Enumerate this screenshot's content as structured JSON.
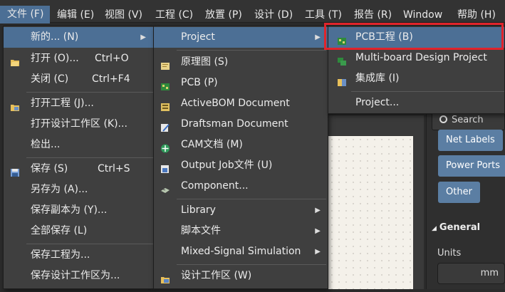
{
  "menubar": {
    "items": [
      {
        "label": "文件 (F)"
      },
      {
        "label": "编辑 (E)"
      },
      {
        "label": "视图 (V)"
      },
      {
        "label": "工程 (C)"
      },
      {
        "label": "放置 (P)"
      },
      {
        "label": "设计 (D)"
      },
      {
        "label": "工具 (T)"
      },
      {
        "label": "报告 (R)"
      },
      {
        "label": "Window"
      },
      {
        "label": "帮助 (H)"
      }
    ]
  },
  "file_menu": {
    "items": [
      {
        "label": "新的... (N)",
        "shortcut": ""
      },
      {
        "label": "打开 (O)...",
        "shortcut": "Ctrl+O"
      },
      {
        "label": "关闭 (C)",
        "shortcut": "Ctrl+F4"
      },
      {
        "label": "打开工程 (J)...",
        "shortcut": ""
      },
      {
        "label": "打开设计工作区 (K)...",
        "shortcut": ""
      },
      {
        "label": "检出...",
        "shortcut": ""
      },
      {
        "label": "保存 (S)",
        "shortcut": "Ctrl+S"
      },
      {
        "label": "另存为 (A)...",
        "shortcut": ""
      },
      {
        "label": "保存副本为 (Y)...",
        "shortcut": ""
      },
      {
        "label": "全部保存 (L)",
        "shortcut": ""
      },
      {
        "label": "保存工程为...",
        "shortcut": ""
      },
      {
        "label": "保存设计工作区为...",
        "shortcut": ""
      }
    ]
  },
  "new_menu": {
    "items": [
      {
        "label": "Project"
      },
      {
        "label": "原理图 (S)"
      },
      {
        "label": "PCB (P)"
      },
      {
        "label": "ActiveBOM Document"
      },
      {
        "label": "Draftsman Document"
      },
      {
        "label": "CAM文档 (M)"
      },
      {
        "label": "Output Job文件 (U)"
      },
      {
        "label": "Component..."
      },
      {
        "label": "Library"
      },
      {
        "label": "脚本文件"
      },
      {
        "label": "Mixed-Signal Simulation"
      },
      {
        "label": "设计工作区 (W)"
      }
    ]
  },
  "project_menu": {
    "items": [
      {
        "label": "PCB工程 (B)"
      },
      {
        "label": "Multi-board Design Project"
      },
      {
        "label": "集成库 (I)"
      },
      {
        "label": "Project..."
      }
    ]
  },
  "panel": {
    "search_placeholder": "Search",
    "chips": [
      "Net Labels",
      "Power Ports",
      "Other"
    ],
    "section_title": "General",
    "units_label": "Units",
    "units_value": "mm"
  },
  "colors": {
    "highlight": "#4c6f95",
    "callout_border": "#e0242b",
    "menu_bg": "#3f3f3f"
  }
}
